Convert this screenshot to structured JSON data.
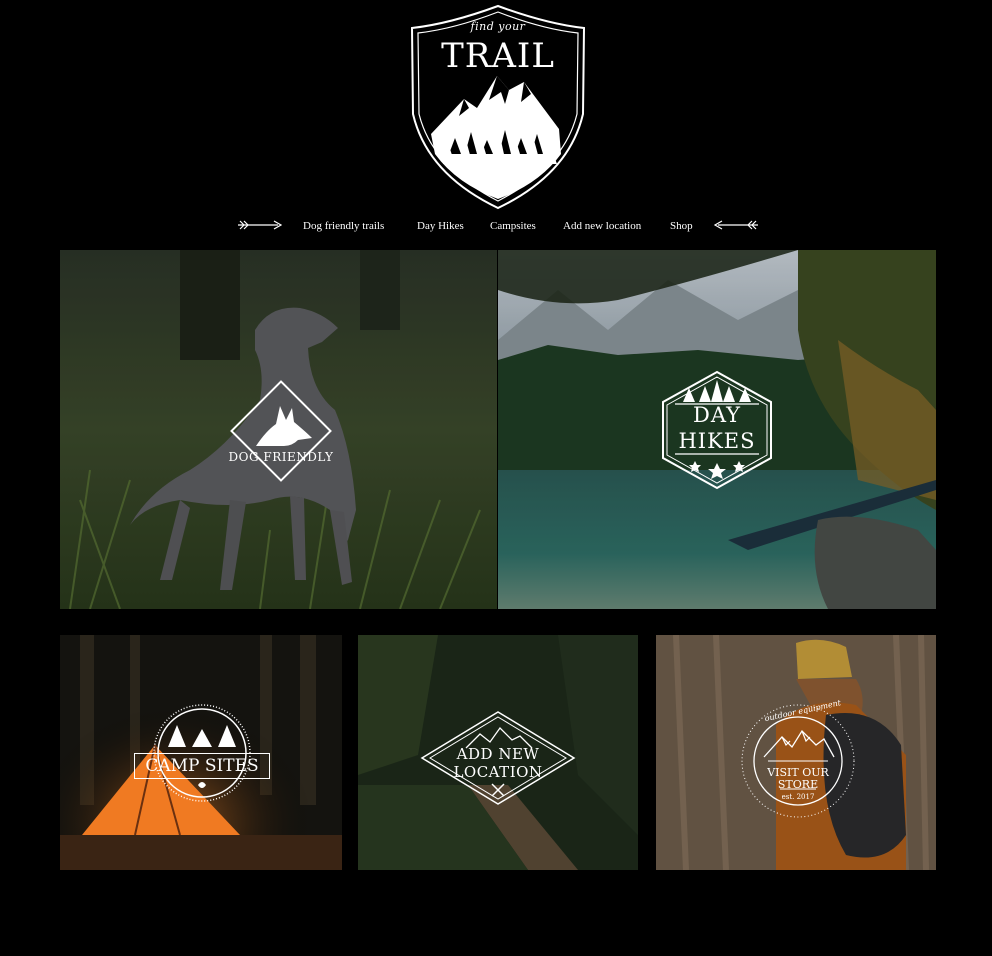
{
  "logo": {
    "top_text": "find your",
    "title": "TRAIL"
  },
  "nav": {
    "items": [
      {
        "label": "Dog friendly trails"
      },
      {
        "label": "Day Hikes"
      },
      {
        "label": "Campsites"
      },
      {
        "label": "Add new location"
      },
      {
        "label": "Shop"
      }
    ]
  },
  "tiles": {
    "dog": {
      "label": "DOG FRIENDLY"
    },
    "dayhikes": {
      "line1": "DAY",
      "line2": "HIKES"
    },
    "camp": {
      "label": "CAMP SITES"
    },
    "addnew": {
      "line1": "ADD NEW",
      "line2": "LOCATION"
    },
    "store": {
      "arc": "outdoor equipment",
      "line1": "VISIT OUR",
      "line2": "STORE",
      "est": "est. 2017"
    }
  },
  "colors": {
    "background": "#000000",
    "foreground": "#ffffff"
  }
}
